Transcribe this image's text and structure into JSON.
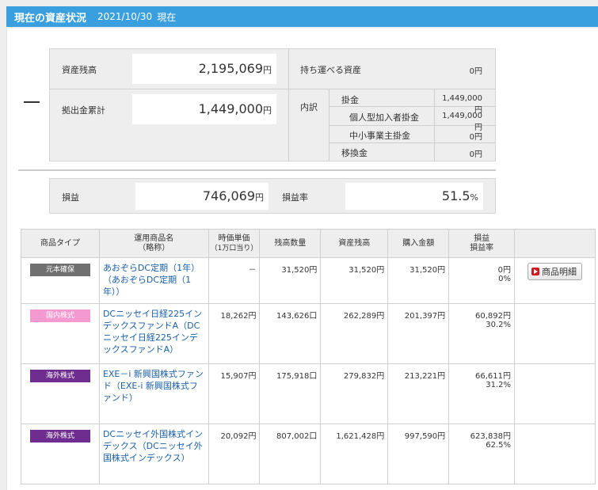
{
  "header": {
    "title": "現在の資産状況",
    "date": "2021/10/30",
    "suffix": "現在"
  },
  "summary": {
    "asset_balance_label": "資産残高",
    "asset_balance_value": "2,195,069",
    "contribution_total_label": "拠出金累計",
    "contribution_total_value": "1,449,000",
    "unit": "円",
    "portable_label": "持ち運べる資産",
    "portable_value": "0円",
    "breakdown_label": "内訳",
    "breakdown": [
      {
        "label": "掛金",
        "value": "1,449,000円"
      },
      {
        "label": "個人型加入者掛金",
        "value": "1,449,000円"
      },
      {
        "label": "中小事業主掛金",
        "value": "0円"
      },
      {
        "label": "移換金",
        "value": "0円"
      }
    ]
  },
  "profit": {
    "label": "損益",
    "value": "746,069",
    "unit": "円",
    "rate_label": "損益率",
    "rate_value": "51.5",
    "rate_unit": "%"
  },
  "table": {
    "headers": {
      "type": "商品タイプ",
      "name_1": "運用商品名",
      "name_2": "（略称）",
      "price_1": "時価単価",
      "price_2": "（1万口当り）",
      "units": "残高数量",
      "balance": "資産残高",
      "purchase": "購入金額",
      "pl_1": "損益",
      "pl_2": "損益率"
    },
    "detail_button": "商品明細",
    "rows": [
      {
        "type": "元本確保",
        "type_color": "#707070",
        "name": "あおぞらDC定期（1年）",
        "short": "（あおぞらDC定期（1年））",
        "price": "－",
        "units": "31,520円",
        "balance": "31,520円",
        "purchase": "31,520円",
        "pl": "0円",
        "rate": "0%"
      },
      {
        "type": "国内株式",
        "type_color": "#f59ad0",
        "name": "DCニッセイ日経225インデックスファンドA",
        "short": "（DCニッセイ日経225インデックスファンドA）",
        "price": "18,262円",
        "units": "143,626口",
        "balance": "262,289円",
        "purchase": "201,397円",
        "pl": "60,892円",
        "rate": "30.2%"
      },
      {
        "type": "海外株式",
        "type_color": "#6f2e8f",
        "name": "EXE－i 新興国株式ファンド",
        "short": "（EXE-i 新興国株式ファンド）",
        "price": "15,907円",
        "units": "175,918口",
        "balance": "279,832円",
        "purchase": "213,221円",
        "pl": "66,611円",
        "rate": "31.2%"
      },
      {
        "type": "海外株式",
        "type_color": "#6f2e8f",
        "name": "DCニッセイ外国株式インデックス",
        "short": "（DCニッセイ外国株式インデックス）",
        "price": "20,092円",
        "units": "807,002口",
        "balance": "1,621,428円",
        "purchase": "997,590円",
        "pl": "623,838円",
        "rate": "62.5%"
      }
    ]
  }
}
